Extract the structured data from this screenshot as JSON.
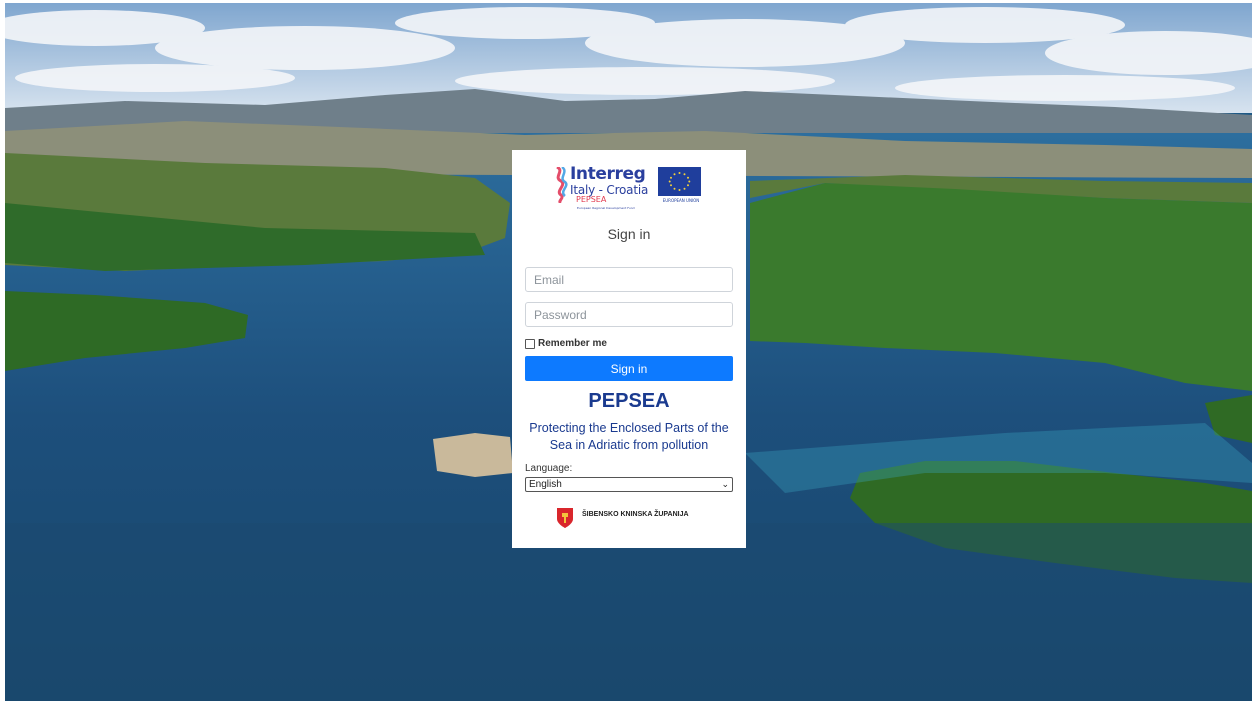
{
  "logo": {
    "program_name": "Interreg",
    "region": "Italy - Croatia",
    "project": "PEPSEA",
    "fund": "European Regional Development Fund",
    "eu_label": "EUROPEAN UNION"
  },
  "form": {
    "title": "Sign in",
    "email_placeholder": "Email",
    "password_placeholder": "Password",
    "remember_label": "Remember me",
    "submit_label": "Sign in"
  },
  "brand": {
    "name": "PEPSEA",
    "tagline": "Protecting the Enclosed Parts of the Sea in Adriatic from pollution"
  },
  "language": {
    "label": "Language:",
    "selected": "English"
  },
  "footer": {
    "county": "ŠIBENSKO KNINSKA ŽUPANIJA"
  },
  "colors": {
    "accent": "#0d7aff",
    "brand_text": "#1a3a8f"
  }
}
